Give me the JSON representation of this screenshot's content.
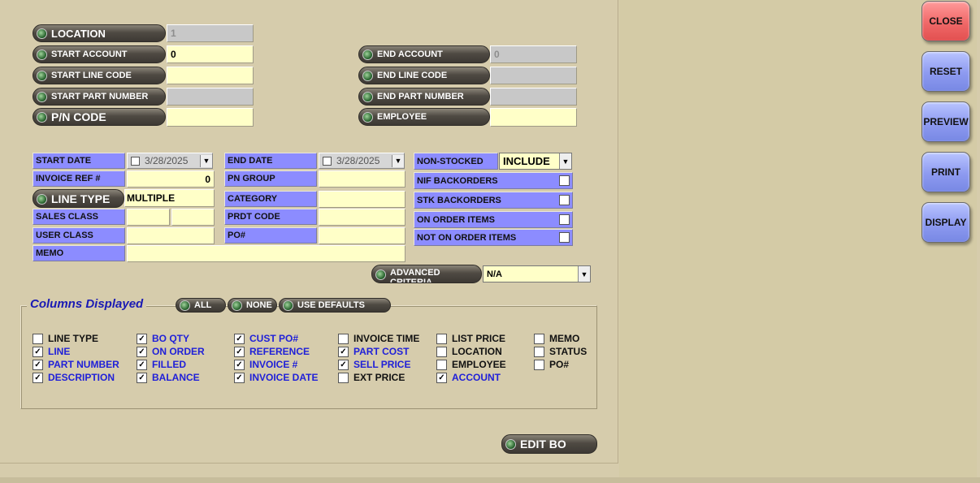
{
  "filters": {
    "location": {
      "label": "LOCATION",
      "value": "1"
    },
    "start_account": {
      "label": "START ACCOUNT",
      "value": "0"
    },
    "start_line_code": {
      "label": "START LINE CODE",
      "value": ""
    },
    "start_part_number": {
      "label": "START PART NUMBER",
      "value": ""
    },
    "pn_code": {
      "label": "P/N CODE",
      "value": ""
    },
    "end_account": {
      "label": "END ACCOUNT",
      "value": "0"
    },
    "end_line_code": {
      "label": "END LINE CODE",
      "value": ""
    },
    "end_part_number": {
      "label": "END PART NUMBER",
      "value": ""
    },
    "employee": {
      "label": "EMPLOYEE",
      "value": ""
    }
  },
  "criteria": {
    "start_date": {
      "label": "START DATE",
      "value": "3/28/2025"
    },
    "invoice_ref": {
      "label": "INVOICE REF #",
      "value": "0"
    },
    "line_type": {
      "label": "LINE TYPE",
      "value": "MULTIPLE"
    },
    "sales_class": {
      "label": "SALES CLASS",
      "value1": "",
      "value2": ""
    },
    "user_class": {
      "label": "USER CLASS",
      "value": ""
    },
    "memo": {
      "label": "MEMO",
      "value": ""
    },
    "end_date": {
      "label": "END DATE",
      "value": "3/28/2025"
    },
    "pn_group": {
      "label": "PN GROUP",
      "value": ""
    },
    "category": {
      "label": "CATEGORY",
      "value": ""
    },
    "prdt_code": {
      "label": "PRDT CODE",
      "value": ""
    },
    "po": {
      "label": "PO#",
      "value": ""
    }
  },
  "options": {
    "non_stocked": {
      "label": "NON-STOCKED",
      "value": "INCLUDE"
    },
    "nif_backorders": {
      "label": "NIF BACKORDERS",
      "checked": false
    },
    "stk_backorders": {
      "label": "STK BACKORDERS",
      "checked": false
    },
    "on_order_items": {
      "label": "ON ORDER ITEMS",
      "checked": false
    },
    "not_on_order_items": {
      "label": "NOT ON ORDER ITEMS",
      "checked": false
    },
    "advanced_criteria": {
      "label": "ADVANCED CRITERIA",
      "value": "N/A"
    }
  },
  "columns": {
    "title": "Columns Displayed",
    "all_label": "ALL",
    "none_label": "NONE",
    "defaults_label": "USE DEFAULTS",
    "groups": [
      [
        {
          "label": "LINE TYPE",
          "checked": false
        },
        {
          "label": "LINE",
          "checked": true
        },
        {
          "label": "PART NUMBER",
          "checked": true
        },
        {
          "label": "DESCRIPTION",
          "checked": true
        }
      ],
      [
        {
          "label": "BO QTY",
          "checked": true
        },
        {
          "label": "ON ORDER",
          "checked": true
        },
        {
          "label": "FILLED",
          "checked": true
        },
        {
          "label": "BALANCE",
          "checked": true
        }
      ],
      [
        {
          "label": "CUST PO#",
          "checked": true
        },
        {
          "label": "REFERENCE",
          "checked": true
        },
        {
          "label": "INVOICE  #",
          "checked": true
        },
        {
          "label": "INVOICE DATE",
          "checked": true
        }
      ],
      [
        {
          "label": "INVOICE TIME",
          "checked": false
        },
        {
          "label": "PART COST",
          "checked": true
        },
        {
          "label": "SELL PRICE",
          "checked": true
        },
        {
          "label": "EXT PRICE",
          "checked": false
        }
      ],
      [
        {
          "label": "LIST PRICE",
          "checked": false
        },
        {
          "label": "LOCATION",
          "checked": false
        },
        {
          "label": "EMPLOYEE",
          "checked": false
        },
        {
          "label": "ACCOUNT",
          "checked": true
        }
      ],
      [
        {
          "label": "MEMO",
          "checked": false
        },
        {
          "label": "STATUS",
          "checked": false
        },
        {
          "label": "PO#",
          "checked": false
        }
      ]
    ]
  },
  "edit_bo_label": "EDIT BO",
  "actions": {
    "close": "CLOSE",
    "reset": "RESET",
    "preview": "PREVIEW",
    "print": "PRINT",
    "display": "DISPLAY"
  },
  "colors": {
    "background": "#d6ccac",
    "label_blue": "#8c8cff",
    "field_yellow": "#ffffc8",
    "checked_text": "#2020d8",
    "close_red": "#f06868",
    "button_blue": "#8d9af0"
  }
}
